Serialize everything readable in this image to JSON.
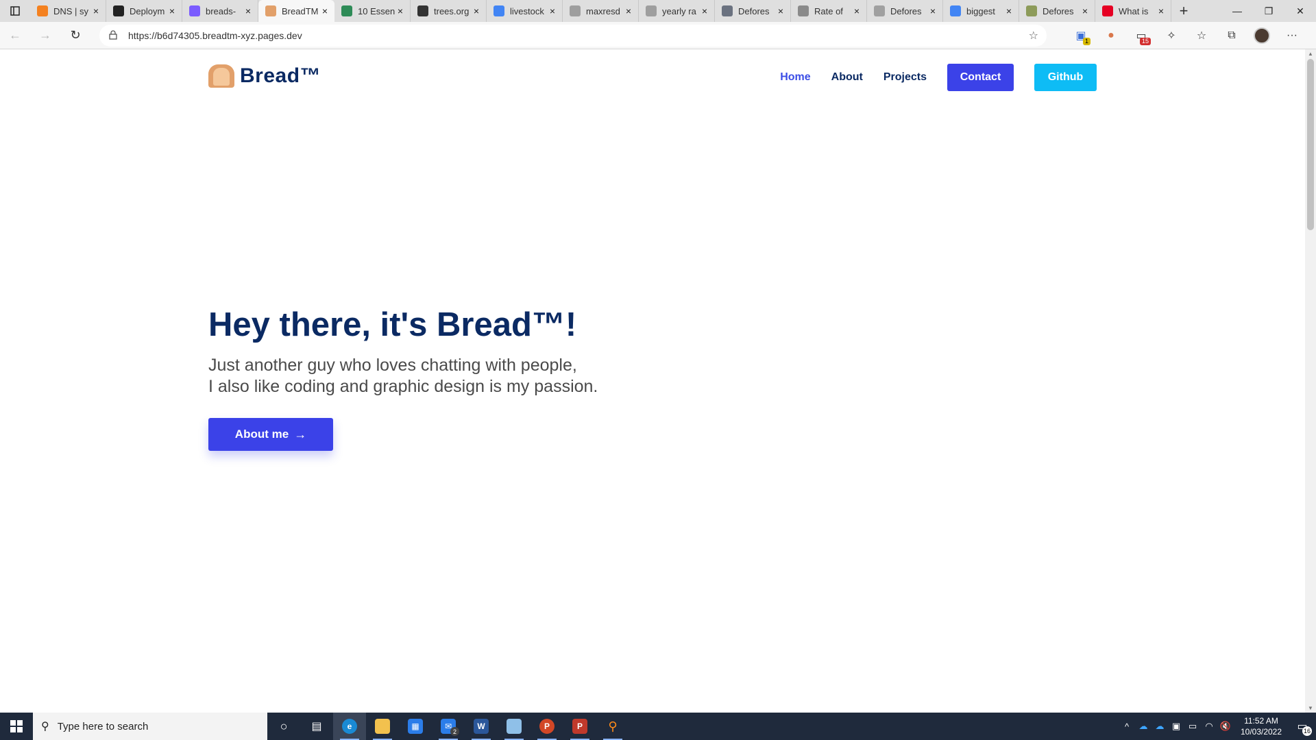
{
  "browser": {
    "tabs": [
      {
        "label": "DNS | sy",
        "icon": "cloudflare-icon",
        "color": "#f48120"
      },
      {
        "label": "Deploym",
        "icon": "github-icon",
        "color": "#222222"
      },
      {
        "label": "breads-",
        "icon": "pages-icon",
        "color": "#7b5cff"
      },
      {
        "label": "BreadTM",
        "icon": "bread-icon",
        "color": "#e2a06a",
        "active": true
      },
      {
        "label": "10 Essen",
        "icon": "tree-icon",
        "color": "#2e8b57"
      },
      {
        "label": "trees.org",
        "icon": "trees-icon",
        "color": "#333333"
      },
      {
        "label": "livestock",
        "icon": "google-icon",
        "color": "#4285f4"
      },
      {
        "label": "maxresd",
        "icon": "file-icon",
        "color": "#9e9e9e"
      },
      {
        "label": "yearly ra",
        "icon": "google-icon",
        "color": "#9e9e9e"
      },
      {
        "label": "Defores",
        "icon": "globe-icon",
        "color": "#6b7280"
      },
      {
        "label": "Rate of",
        "icon": "doc-icon",
        "color": "#8a8a8a"
      },
      {
        "label": "Defores",
        "icon": "leaf-icon",
        "color": "#a0a0a0"
      },
      {
        "label": "biggest",
        "icon": "google-icon",
        "color": "#4285f4"
      },
      {
        "label": "Defores",
        "icon": "leaf-icon",
        "color": "#8d9b5a"
      },
      {
        "label": "What is",
        "icon": "pinterest-icon",
        "color": "#e60023"
      }
    ],
    "url": "https://b6d74305.breadtm-xyz.pages.dev",
    "toolbar_badges": {
      "ext1": "1",
      "ext2": "15"
    }
  },
  "site": {
    "brand": "Bread™",
    "nav": {
      "home": "Home",
      "about": "About",
      "projects": "Projects",
      "contact": "Contact",
      "github": "Github"
    },
    "hero": {
      "title": "Hey there, it's Bread™!",
      "line1": "Just another guy who loves chatting with people,",
      "line2": "I also like coding and graphic design is my passion.",
      "cta": "About me"
    },
    "colors": {
      "primary": "#3b42e8",
      "navy": "#0b2a63",
      "cyan": "#0ebcf5"
    }
  },
  "taskbar": {
    "search_placeholder": "Type here to search",
    "mail_badge": "2",
    "time": "11:52 AM",
    "date": "10/03/2022",
    "notifications": "16"
  }
}
